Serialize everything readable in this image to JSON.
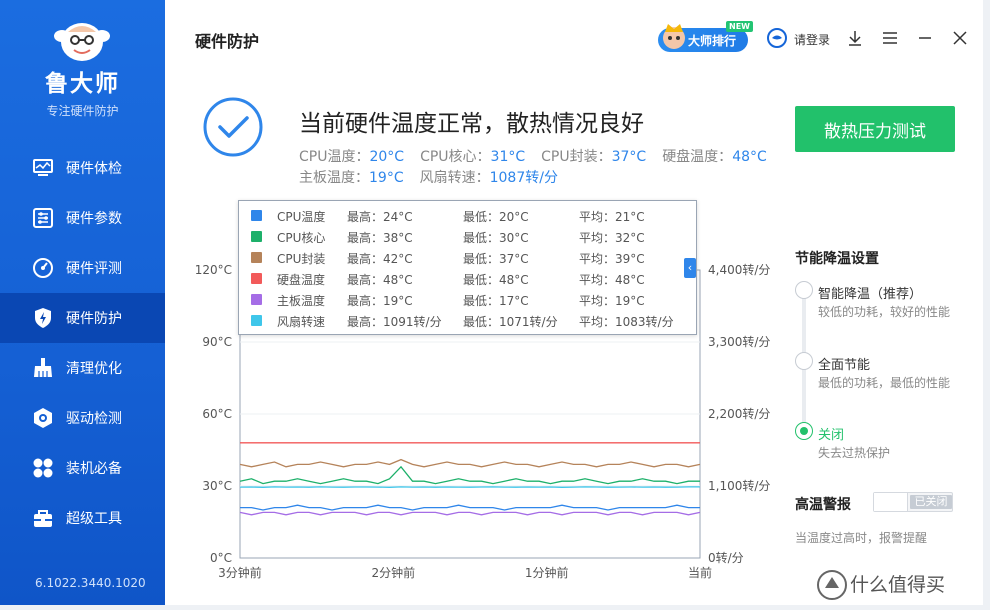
{
  "app": {
    "name": "鲁大师",
    "slogan": "专注硬件防护",
    "version": "6.1022.3440.1020"
  },
  "sidebar": {
    "items": [
      {
        "label": "硬件体检",
        "icon": "monitor-icon",
        "active": false
      },
      {
        "label": "硬件参数",
        "icon": "sliders-icon",
        "active": false
      },
      {
        "label": "硬件评测",
        "icon": "speedometer-icon",
        "active": false
      },
      {
        "label": "硬件防护",
        "icon": "shield-bolt-icon",
        "active": true
      },
      {
        "label": "清理优化",
        "icon": "broom-icon",
        "active": false
      },
      {
        "label": "驱动检测",
        "icon": "gear-shield-icon",
        "active": false
      },
      {
        "label": "装机必备",
        "icon": "apps-grid-icon",
        "active": false
      },
      {
        "label": "超级工具",
        "icon": "toolbox-icon",
        "active": false
      }
    ]
  },
  "header": {
    "title": "硬件防护",
    "rank_label": "大师排行",
    "new_badge": "NEW",
    "login_label": "请登录"
  },
  "status": {
    "title": "当前硬件温度正常，散热情况良好",
    "stress_button": "散热压力测试",
    "readings": [
      {
        "label": "CPU温度：",
        "value": "20°C"
      },
      {
        "label": "CPU核心：",
        "value": "31°C"
      },
      {
        "label": "CPU封装：",
        "value": "37°C"
      },
      {
        "label": "硬盘温度：",
        "value": "48°C"
      },
      {
        "label": "主板温度：",
        "value": "19°C"
      },
      {
        "label": "风扇转速：",
        "value": "1087转/分"
      }
    ]
  },
  "legend": {
    "rows": [
      {
        "name": "CPU温度",
        "max": "最高：24°C",
        "min": "最低：20°C",
        "avg": "平均：21°C",
        "color": "#2f86ea"
      },
      {
        "name": "CPU核心",
        "max": "最高：38°C",
        "min": "最低：30°C",
        "avg": "平均：32°C",
        "color": "#1db06a"
      },
      {
        "name": "CPU封装",
        "max": "最高：42°C",
        "min": "最低：37°C",
        "avg": "平均：39°C",
        "color": "#b5835a"
      },
      {
        "name": "硬盘温度",
        "max": "最高：48°C",
        "min": "最低：48°C",
        "avg": "平均：48°C",
        "color": "#f25a5a"
      },
      {
        "name": "主板温度",
        "max": "最高：19°C",
        "min": "最低：17°C",
        "avg": "平均：19°C",
        "color": "#a56de6"
      },
      {
        "name": "风扇转速",
        "max": "最高：1091转/分",
        "min": "最低：1071转/分",
        "avg": "平均：1083转/分",
        "color": "#3fc6ea"
      }
    ],
    "collapse_glyph": "‹"
  },
  "chart_data": {
    "type": "line",
    "x_ticks": [
      "3分钟前",
      "2分钟前",
      "1分钟前",
      "当前"
    ],
    "y_left_ticks": [
      "120°C",
      "90°C",
      "60°C",
      "30°C",
      "0°C"
    ],
    "y_right_ticks": [
      "4,400转/分",
      "3,300转/分",
      "2,200转/分",
      "1,100转/分",
      "0转/分"
    ],
    "ylim_left": [
      0,
      120
    ],
    "ylim_right": [
      0,
      4400
    ],
    "series": [
      {
        "name": "CPU温度",
        "axis": "left",
        "color": "#2f86ea",
        "values": [
          21,
          21,
          20,
          21,
          21,
          22,
          21,
          21,
          20,
          21,
          21,
          21,
          22,
          21,
          21,
          20,
          21,
          21,
          21,
          22,
          21,
          21,
          21,
          20,
          21,
          21,
          21,
          21,
          22,
          21,
          21,
          21,
          20,
          21,
          21,
          21,
          21,
          21,
          22,
          21,
          21
        ]
      },
      {
        "name": "CPU核心",
        "axis": "left",
        "color": "#1db06a",
        "values": [
          32,
          33,
          31,
          32,
          32,
          33,
          32,
          31,
          32,
          33,
          32,
          32,
          31,
          33,
          38,
          32,
          32,
          31,
          32,
          33,
          32,
          32,
          31,
          32,
          33,
          32,
          32,
          31,
          32,
          32,
          33,
          32,
          31,
          32,
          32,
          33,
          32,
          32,
          31,
          32,
          32
        ]
      },
      {
        "name": "CPU封装",
        "axis": "left",
        "color": "#b5835a",
        "values": [
          39,
          38,
          39,
          40,
          38,
          39,
          39,
          40,
          39,
          38,
          39,
          39,
          40,
          39,
          41,
          39,
          38,
          39,
          40,
          39,
          39,
          38,
          39,
          40,
          39,
          39,
          38,
          39,
          40,
          39,
          39,
          38,
          39,
          39,
          40,
          39,
          38,
          39,
          39,
          38,
          39
        ]
      },
      {
        "name": "硬盘温度",
        "axis": "left",
        "color": "#f25a5a",
        "values": [
          48,
          48,
          48,
          48,
          48,
          48,
          48,
          48,
          48,
          48,
          48,
          48,
          48,
          48,
          48,
          48,
          48,
          48,
          48,
          48,
          48,
          48,
          48,
          48,
          48,
          48,
          48,
          48,
          48,
          48,
          48,
          48,
          48,
          48,
          48,
          48,
          48,
          48,
          48,
          48,
          48
        ]
      },
      {
        "name": "主板温度",
        "axis": "left",
        "color": "#a56de6",
        "values": [
          19,
          18,
          19,
          19,
          18,
          19,
          19,
          18,
          19,
          19,
          19,
          18,
          19,
          19,
          18,
          19,
          19,
          19,
          18,
          19,
          19,
          18,
          19,
          19,
          19,
          18,
          19,
          19,
          18,
          19,
          19,
          19,
          18,
          19,
          19,
          18,
          19,
          19,
          19,
          18,
          19
        ]
      },
      {
        "name": "风扇转速",
        "axis": "right",
        "color": "#3fc6ea",
        "values": [
          1083,
          1085,
          1080,
          1087,
          1083,
          1084,
          1082,
          1086,
          1083,
          1081,
          1084,
          1085,
          1083,
          1080,
          1086,
          1083,
          1084,
          1082,
          1085,
          1083,
          1081,
          1084,
          1086,
          1083,
          1082,
          1085,
          1083,
          1084,
          1080,
          1083,
          1086,
          1084,
          1082,
          1083,
          1085,
          1083,
          1084,
          1082,
          1083,
          1086,
          1087
        ]
      }
    ]
  },
  "settings": {
    "eco_title": "节能降温设置",
    "options": [
      {
        "label": "智能降温（推荐）",
        "desc": "较低的功耗，较好的性能",
        "selected": false
      },
      {
        "label": "全面节能",
        "desc": "最低的功耗，最低的性能",
        "selected": false
      },
      {
        "label": "关闭",
        "desc": "失去过热保护",
        "selected": true
      }
    ],
    "alarm_title": "高温警报",
    "alarm_state": "已关闭",
    "alarm_desc": "当温度过高时，报警提醒"
  },
  "watermark": {
    "text": "什么值得买"
  },
  "colors": {
    "accent": "#2f86ea",
    "success": "#22c16b",
    "sidebar": "#1565d8"
  }
}
